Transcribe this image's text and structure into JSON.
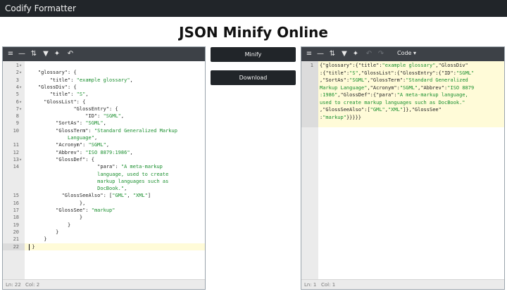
{
  "app": {
    "brand": "Codify Formatter"
  },
  "page": {
    "title": "JSON Minify Online"
  },
  "actions": {
    "minify_label": "Minify",
    "download_label": "Download"
  },
  "left_editor": {
    "toolbar_icons": [
      "format-icon",
      "compact-icon",
      "sort-icon",
      "filter-icon",
      "repair-icon",
      "undo-icon"
    ],
    "lines": [
      [
        {
          "t": "{",
          "c": "p"
        }
      ],
      [
        {
          "t": "  ",
          "c": "p"
        }
      ],
      [
        {
          "t": "    ",
          "c": "p"
        },
        {
          "t": "\"glossary\"",
          "c": "k"
        },
        {
          "t": ": {",
          "c": "p"
        }
      ],
      [
        {
          "t": "        ",
          "c": "p"
        },
        {
          "t": "\"title\"",
          "c": "k"
        },
        {
          "t": ": ",
          "c": "p"
        },
        {
          "t": "\"example glossary\"",
          "c": "s"
        },
        {
          "t": ",",
          "c": "p"
        }
      ],
      [
        {
          "t": "    ",
          "c": "p"
        },
        {
          "t": "\"GlossDiv\"",
          "c": "k"
        },
        {
          "t": ": {",
          "c": "p"
        }
      ],
      [
        {
          "t": "        ",
          "c": "p"
        },
        {
          "t": "\"title\"",
          "c": "k"
        },
        {
          "t": ": ",
          "c": "p"
        },
        {
          "t": "\"S\"",
          "c": "s"
        },
        {
          "t": ",",
          "c": "p"
        }
      ],
      [
        {
          "t": "      ",
          "c": "p"
        },
        {
          "t": "\"GlossList\"",
          "c": "k"
        },
        {
          "t": ": {",
          "c": "p"
        }
      ],
      [
        {
          "t": "                ",
          "c": "p"
        },
        {
          "t": "\"GlossEntry\"",
          "c": "k"
        },
        {
          "t": ": {",
          "c": "p"
        }
      ],
      [
        {
          "t": "                    ",
          "c": "p"
        },
        {
          "t": "\"ID\"",
          "c": "k"
        },
        {
          "t": ": ",
          "c": "p"
        },
        {
          "t": "\"SGML\"",
          "c": "s"
        },
        {
          "t": ",",
          "c": "p"
        }
      ],
      [
        {
          "t": "          ",
          "c": "p"
        },
        {
          "t": "\"SortAs\"",
          "c": "k"
        },
        {
          "t": ": ",
          "c": "p"
        },
        {
          "t": "\"SGML\"",
          "c": "s"
        },
        {
          "t": ",",
          "c": "p"
        }
      ],
      [
        {
          "t": "          ",
          "c": "p"
        },
        {
          "t": "\"GlossTerm\"",
          "c": "k"
        },
        {
          "t": ": ",
          "c": "p"
        },
        {
          "t": "\"Standard Generalized Markup",
          "c": "s"
        }
      ],
      [
        {
          "t": "              ",
          "c": "p"
        },
        {
          "t": "Language\"",
          "c": "s"
        },
        {
          "t": ",",
          "c": "p"
        }
      ],
      [
        {
          "t": "          ",
          "c": "p"
        },
        {
          "t": "\"Acronym\"",
          "c": "k"
        },
        {
          "t": ": ",
          "c": "p"
        },
        {
          "t": "\"SGML\"",
          "c": "s"
        },
        {
          "t": ",",
          "c": "p"
        }
      ],
      [
        {
          "t": "          ",
          "c": "p"
        },
        {
          "t": "\"Abbrev\"",
          "c": "k"
        },
        {
          "t": ": ",
          "c": "p"
        },
        {
          "t": "\"ISO 8879:1986\"",
          "c": "s"
        },
        {
          "t": ",",
          "c": "p"
        }
      ],
      [
        {
          "t": "          ",
          "c": "p"
        },
        {
          "t": "\"GlossDef\"",
          "c": "k"
        },
        {
          "t": ": {",
          "c": "p"
        }
      ],
      [
        {
          "t": "                        ",
          "c": "p"
        },
        {
          "t": "\"para\"",
          "c": "k"
        },
        {
          "t": ": ",
          "c": "p"
        },
        {
          "t": "\"A meta-markup",
          "c": "s"
        }
      ],
      [
        {
          "t": "                        ",
          "c": "p"
        },
        {
          "t": "language, used to create",
          "c": "s"
        }
      ],
      [
        {
          "t": "                        ",
          "c": "p"
        },
        {
          "t": "markup languages such as",
          "c": "s"
        }
      ],
      [
        {
          "t": "                        ",
          "c": "p"
        },
        {
          "t": "DocBook.\"",
          "c": "s"
        },
        {
          "t": ",",
          "c": "p"
        }
      ],
      [
        {
          "t": "            ",
          "c": "p"
        },
        {
          "t": "\"GlossSeeAlso\"",
          "c": "k"
        },
        {
          "t": ": [",
          "c": "p"
        },
        {
          "t": "\"GML\"",
          "c": "s"
        },
        {
          "t": ", ",
          "c": "p"
        },
        {
          "t": "\"XML\"",
          "c": "s"
        },
        {
          "t": "]",
          "c": "p"
        }
      ],
      [
        {
          "t": "                  },",
          "c": "p"
        }
      ],
      [
        {
          "t": "          ",
          "c": "p"
        },
        {
          "t": "\"GlossSee\"",
          "c": "k"
        },
        {
          "t": ": ",
          "c": "p"
        },
        {
          "t": "\"markup\"",
          "c": "s"
        }
      ],
      [
        {
          "t": "                  }",
          "c": "p"
        }
      ],
      [
        {
          "t": "              }",
          "c": "p"
        }
      ],
      [
        {
          "t": "          }",
          "c": "p"
        }
      ],
      [
        {
          "t": "      }",
          "c": "p"
        }
      ],
      [
        {
          "t": "  }",
          "c": "p"
        }
      ],
      [
        {
          "t": "",
          "c": "p"
        }
      ]
    ],
    "line_numbers": [
      {
        "n": "1",
        "fold": true
      },
      {
        "n": "2",
        "fold": true
      },
      {
        "n": "3",
        "fold": false
      },
      {
        "n": "4",
        "fold": true
      },
      {
        "n": "5",
        "fold": false
      },
      {
        "n": "6",
        "fold": true
      },
      {
        "n": "7",
        "fold": true
      },
      {
        "n": "8",
        "fold": false
      },
      {
        "n": "9",
        "fold": false
      },
      {
        "n": "10",
        "fold": false
      },
      {
        "n": "",
        "fold": false
      },
      {
        "n": "11",
        "fold": false
      },
      {
        "n": "12",
        "fold": false
      },
      {
        "n": "13",
        "fold": true
      },
      {
        "n": "14",
        "fold": false
      },
      {
        "n": "",
        "fold": false
      },
      {
        "n": "",
        "fold": false
      },
      {
        "n": "",
        "fold": false
      },
      {
        "n": "15",
        "fold": false
      },
      {
        "n": "16",
        "fold": false
      },
      {
        "n": "17",
        "fold": false
      },
      {
        "n": "18",
        "fold": false
      },
      {
        "n": "19",
        "fold": false
      },
      {
        "n": "20",
        "fold": false
      },
      {
        "n": "21",
        "fold": false
      },
      {
        "n": "22",
        "fold": false
      }
    ],
    "status": {
      "ln": "Ln: 22",
      "col": "Col: 2"
    }
  },
  "right_editor": {
    "toolbar_icons": [
      "format-icon",
      "compact-icon",
      "sort-icon",
      "filter-icon",
      "repair-icon",
      "undo-icon",
      "redo-icon"
    ],
    "mode_label": "Code ▾",
    "lines": [
      [
        {
          "t": "{",
          "c": "p"
        },
        {
          "t": "\"glossary\"",
          "c": "k"
        },
        {
          "t": ":{",
          "c": "p"
        },
        {
          "t": "\"title\"",
          "c": "k"
        },
        {
          "t": ":",
          "c": "p"
        },
        {
          "t": "\"example glossary\"",
          "c": "s"
        },
        {
          "t": ",",
          "c": "p"
        },
        {
          "t": "\"GlossDiv\"",
          "c": "k"
        }
      ],
      [
        {
          "t": ":{",
          "c": "p"
        },
        {
          "t": "\"title\"",
          "c": "k"
        },
        {
          "t": ":",
          "c": "p"
        },
        {
          "t": "\"S\"",
          "c": "s"
        },
        {
          "t": ",",
          "c": "p"
        },
        {
          "t": "\"GlossList\"",
          "c": "k"
        },
        {
          "t": ":{",
          "c": "p"
        },
        {
          "t": "\"GlossEntry\"",
          "c": "k"
        },
        {
          "t": ":{",
          "c": "p"
        },
        {
          "t": "\"ID\"",
          "c": "k"
        },
        {
          "t": ":",
          "c": "p"
        },
        {
          "t": "\"SGML\"",
          "c": "s"
        }
      ],
      [
        {
          "t": ",",
          "c": "p"
        },
        {
          "t": "\"SortAs\"",
          "c": "k"
        },
        {
          "t": ":",
          "c": "p"
        },
        {
          "t": "\"SGML\"",
          "c": "s"
        },
        {
          "t": ",",
          "c": "p"
        },
        {
          "t": "\"GlossTerm\"",
          "c": "k"
        },
        {
          "t": ":",
          "c": "p"
        },
        {
          "t": "\"Standard Generalized",
          "c": "s"
        }
      ],
      [
        {
          "t": "Markup Language\"",
          "c": "s"
        },
        {
          "t": ",",
          "c": "p"
        },
        {
          "t": "\"Acronym\"",
          "c": "k"
        },
        {
          "t": ":",
          "c": "p"
        },
        {
          "t": "\"SGML\"",
          "c": "s"
        },
        {
          "t": ",",
          "c": "p"
        },
        {
          "t": "\"Abbrev\"",
          "c": "k"
        },
        {
          "t": ":",
          "c": "p"
        },
        {
          "t": "\"ISO 8879",
          "c": "s"
        }
      ],
      [
        {
          "t": ":1986\"",
          "c": "s"
        },
        {
          "t": ",",
          "c": "p"
        },
        {
          "t": "\"GlossDef\"",
          "c": "k"
        },
        {
          "t": ":{",
          "c": "p"
        },
        {
          "t": "\"para\"",
          "c": "k"
        },
        {
          "t": ":",
          "c": "p"
        },
        {
          "t": "\"A meta-markup language,",
          "c": "s"
        }
      ],
      [
        {
          "t": "used to create markup languages such as DocBook.\"",
          "c": "s"
        }
      ],
      [
        {
          "t": ",",
          "c": "p"
        },
        {
          "t": "\"GlossSeeAlso\"",
          "c": "k"
        },
        {
          "t": ":[",
          "c": "p"
        },
        {
          "t": "\"GML\"",
          "c": "s"
        },
        {
          "t": ",",
          "c": "p"
        },
        {
          "t": "\"XML\"",
          "c": "s"
        },
        {
          "t": "]},",
          "c": "p"
        },
        {
          "t": "\"GlossSee\"",
          "c": "k"
        }
      ],
      [
        {
          "t": ":",
          "c": "p"
        },
        {
          "t": "\"markup\"",
          "c": "s"
        },
        {
          "t": "}}}}}",
          "c": "p"
        }
      ]
    ],
    "line_numbers": [
      {
        "n": "1",
        "fold": false
      }
    ],
    "status": {
      "ln": "Ln: 1",
      "col": "Col: 1"
    }
  }
}
